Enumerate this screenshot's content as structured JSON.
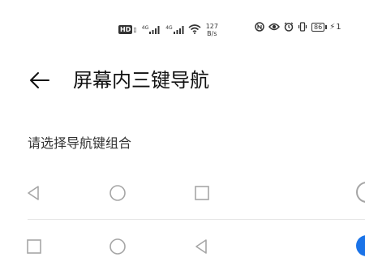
{
  "status_bar": {
    "hd_label": "HD",
    "sim1_tag": "4G",
    "sim2_tag": "4G",
    "net_speed_value": "127",
    "net_speed_unit": "B/s",
    "battery_level": "86",
    "battery_suffix": "1",
    "icons": [
      "hd-icon",
      "signal-icon",
      "signal-icon",
      "wifi-icon",
      "nfc-icon",
      "eye-comfort-icon",
      "alarm-icon",
      "vibrate-icon",
      "battery-icon",
      "charging-icon"
    ]
  },
  "header": {
    "back_icon": "arrow-left-icon",
    "title": "屏幕内三键导航"
  },
  "section": {
    "label": "请选择导航键组合"
  },
  "options": [
    {
      "icons": [
        "triangle-back-icon",
        "circle-home-icon",
        "square-recents-icon"
      ],
      "selected": false
    },
    {
      "icons": [
        "square-recents-icon",
        "circle-home-icon",
        "triangle-back-icon"
      ],
      "selected": true
    }
  ],
  "colors": {
    "accent": "#1a73e8",
    "text": "#111111",
    "secondary_text": "#333333",
    "icon_gray": "#a6a6a6",
    "divider": "#e6e6e6"
  }
}
